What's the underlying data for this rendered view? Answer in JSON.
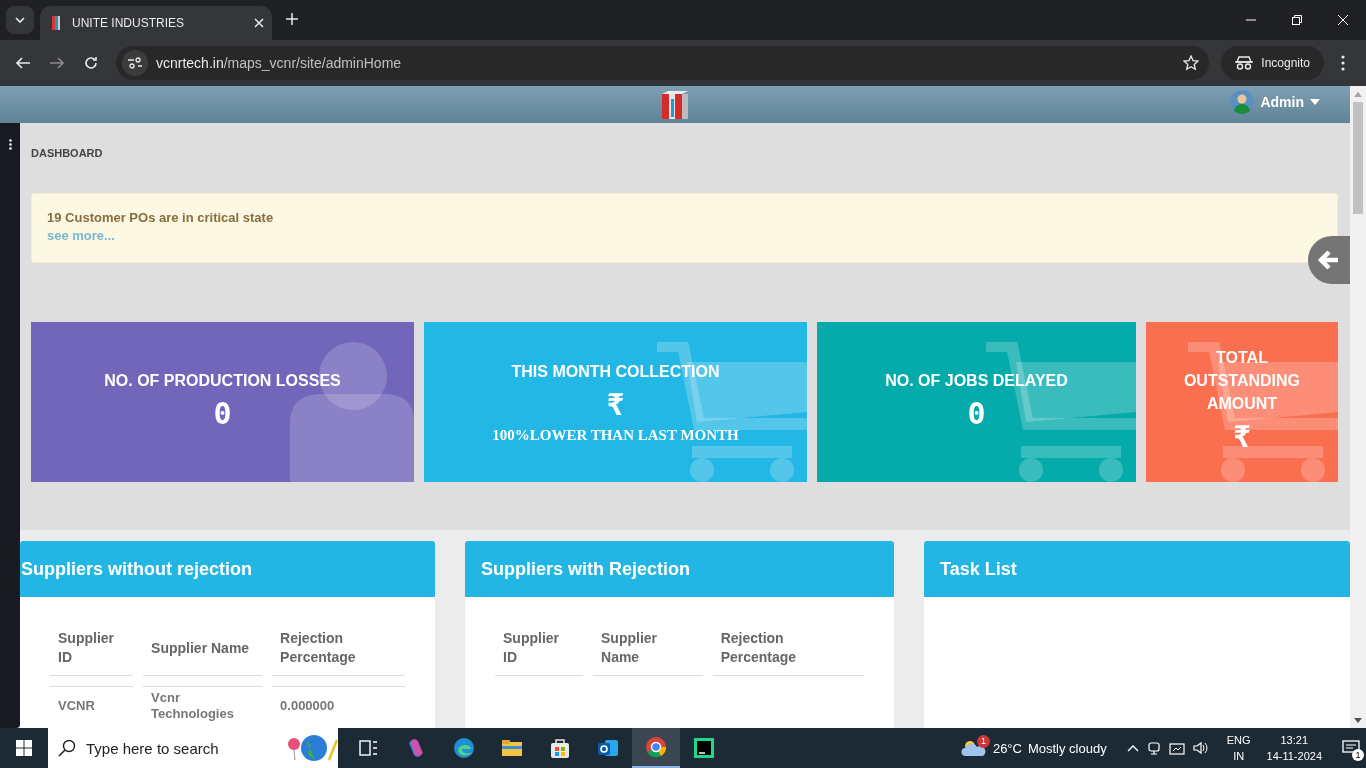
{
  "browser": {
    "tab_title": "UNITE INDUSTRIES",
    "url_domain": "vcnrtech.in",
    "url_path": "/maps_vcnr/site/adminHome",
    "profile": "Incognito"
  },
  "header": {
    "user": "Admin"
  },
  "breadcrumb": "DASHBOARD",
  "alert": {
    "message": "19 Customer POs are in critical state",
    "link": "see more..."
  },
  "stats": [
    {
      "kind": "person",
      "title": "NO. OF PRODUCTION LOSSES",
      "value": "0",
      "color": "#7266ba"
    },
    {
      "kind": "cart",
      "title": "THIS MONTH COLLECTION",
      "value": "₹",
      "note": "100%LOWER THAN LAST MONTH",
      "color": "#23b7e5"
    },
    {
      "kind": "cart",
      "title": "NO. OF JOBS DELAYED",
      "value": "0",
      "color": "#05aaaa"
    },
    {
      "kind": "cart",
      "title": "TOTAL OUTSTANDING AMOUNT",
      "value": "₹",
      "color": "#fb6f51"
    }
  ],
  "panels": [
    {
      "title": "Suppliers without rejection",
      "table": {
        "columns": [
          "Supplier ID",
          "Supplier Name",
          "Rejection Percentage"
        ],
        "rows": [
          [
            "VCNR",
            "Vcnr Technologies",
            "0.000000"
          ]
        ]
      }
    },
    {
      "title": "Suppliers with Rejection",
      "table": {
        "columns": [
          "Supplier ID",
          "Supplier Name",
          "Rejection Percentage"
        ]
      }
    },
    {
      "title": "Task List"
    }
  ],
  "taskbar": {
    "search_placeholder": "Type here to search",
    "apps": [
      {
        "kind": "taskview",
        "selected": false
      },
      {
        "kind": "copilot",
        "selected": false
      },
      {
        "kind": "edge",
        "selected": false
      },
      {
        "kind": "explorer",
        "selected": false
      },
      {
        "kind": "store",
        "selected": false
      },
      {
        "kind": "outlook",
        "selected": false
      },
      {
        "kind": "chrome",
        "selected": true
      },
      {
        "kind": "pycharm",
        "selected": false
      }
    ],
    "weather": {
      "badge": "1",
      "temperature": "26°C",
      "condition": "Mostly cloudy"
    },
    "language": "ENG",
    "region": "IN",
    "time": "13:21",
    "date": "14-11-2024",
    "notifications": "1"
  }
}
